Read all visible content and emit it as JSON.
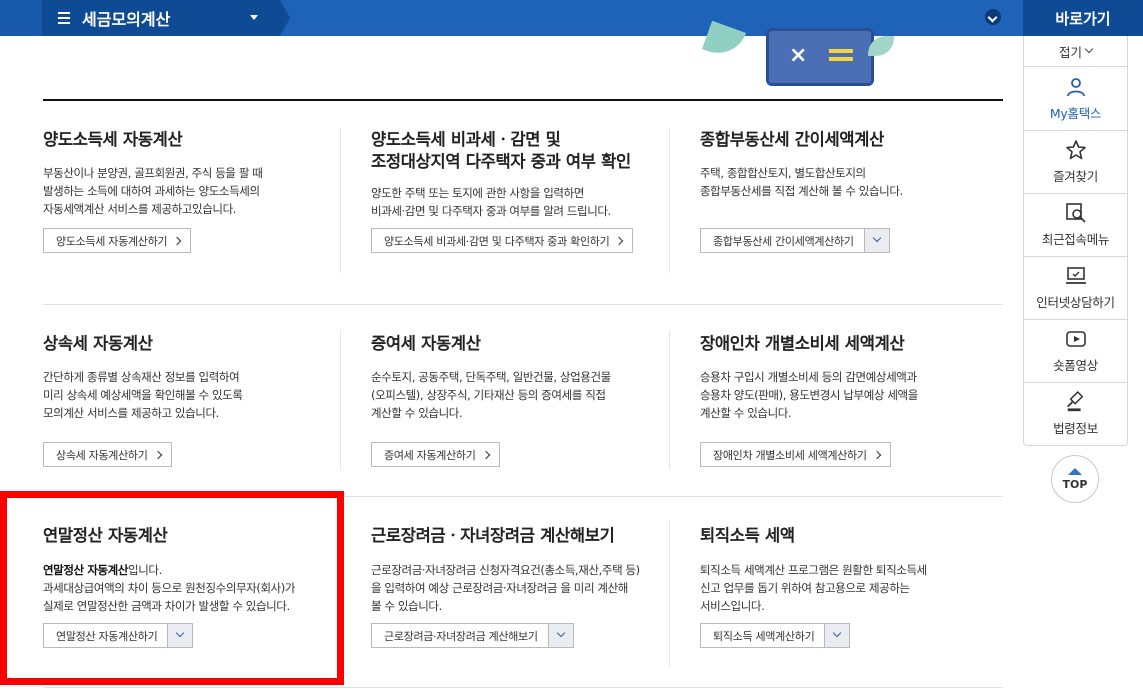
{
  "header": {
    "menu_title": "세금모의계산",
    "quick_title": "바로가기"
  },
  "sidebar": {
    "fold_label": "접기",
    "items": [
      {
        "label": "My홈택스",
        "icon": "person-icon"
      },
      {
        "label": "즐겨찾기",
        "icon": "star-icon"
      },
      {
        "label": "최근접속메뉴",
        "icon": "recent-menu-icon"
      },
      {
        "label": "인터넷상담하기",
        "icon": "consult-icon"
      },
      {
        "label": "숏폼영상",
        "icon": "video-play-icon"
      },
      {
        "label": "법령정보",
        "icon": "gavel-icon"
      }
    ],
    "top_label": "TOP"
  },
  "cards": [
    {
      "title": "양도소득세 자동계산",
      "desc": [
        "부동산이나 분양권, 골프회원권, 주식 등을 팔 때",
        "발생하는 소득에 대하여 과세하는 양도소득세의",
        "자동세액계산 서비스를 제공하고있습니다."
      ],
      "button": "양도소득세 자동계산하기"
    },
    {
      "title": [
        "양도소득세 비과세ㆍ감면 및",
        "조정대상지역 다주택자 중과 여부 확인"
      ],
      "desc": [
        "양도한 주택 또는 토지에 관한 사항을 입력하면",
        "비과세·감면 및 다주택자 중과 여부를 알려 드립니다."
      ],
      "button": "양도소득세 비과세·감면 및 다주택자 중과 확인하기"
    },
    {
      "title": "종합부동산세 간이세액계산",
      "desc": [
        "주택, 종합합산토지, 별도합산토지의",
        "종합부동산세를 직접 계산해 볼 수 있습니다."
      ],
      "button": "종합부동산세 간이세액계산하기"
    },
    {
      "title": "상속세 자동계산",
      "desc": [
        "간단하게 종류별 상속재산 정보를 입력하여",
        "미리 상속세 예상세액을 확인해볼 수 있도록",
        "모의계산 서비스를 제공하고 있습니다."
      ],
      "button": "상속세 자동계산하기"
    },
    {
      "title": "증여세 자동계산",
      "desc": [
        "순수토지, 공동주택, 단독주택, 일반건물, 상업용건물",
        "(오피스텔), 상장주식, 기타재산 등의 증여세를 직접",
        "계산할 수 있습니다."
      ],
      "button": "증여세 자동계산하기"
    },
    {
      "title": "장애인차 개별소비세 세액계산",
      "desc": [
        "승용차 구입시 개별소비세 등의 감면예상세액과",
        "승용차 양도(판매), 용도변경시 납부예상 세액을",
        "계산할 수 있습니다."
      ],
      "button": "장애인차 개별소비세 세액계산하기"
    },
    {
      "title": "연말정산 자동계산",
      "desc_bold": "연말정산 자동계산",
      "desc_rest": "입니다.",
      "desc": [
        "과세대상급여액의 차이 등으로 원천징수의무자(회사)가",
        "실제로 연말정산한 금액과 차이가 발생할 수 있습니다."
      ],
      "button": "연말정산 자동계산하기"
    },
    {
      "title": "근로장려금ㆍ자녀장려금 계산해보기",
      "desc": [
        "근로장려금·자녀장려금 신청자격요건(총소득,재산,주택 등)",
        "을 입력하여 예상 근로장려금·자녀장려금 을 미리 계산해",
        "볼 수 있습니다."
      ],
      "button": "근로장려금·자녀장려금 계산해보기"
    },
    {
      "title": "퇴직소득 세액",
      "desc": [
        "퇴직소득 세액계산 프로그램은 원활한 퇴직소득세",
        "신고 업무를 돕기 위하여 참고용으로 제공하는",
        "서비스입니다."
      ],
      "button": "퇴직소득 세액계산하기"
    }
  ],
  "colors": {
    "topbar": "#1f63b8",
    "dark_blue": "#0f4a94",
    "highlight": "#ff0000"
  }
}
